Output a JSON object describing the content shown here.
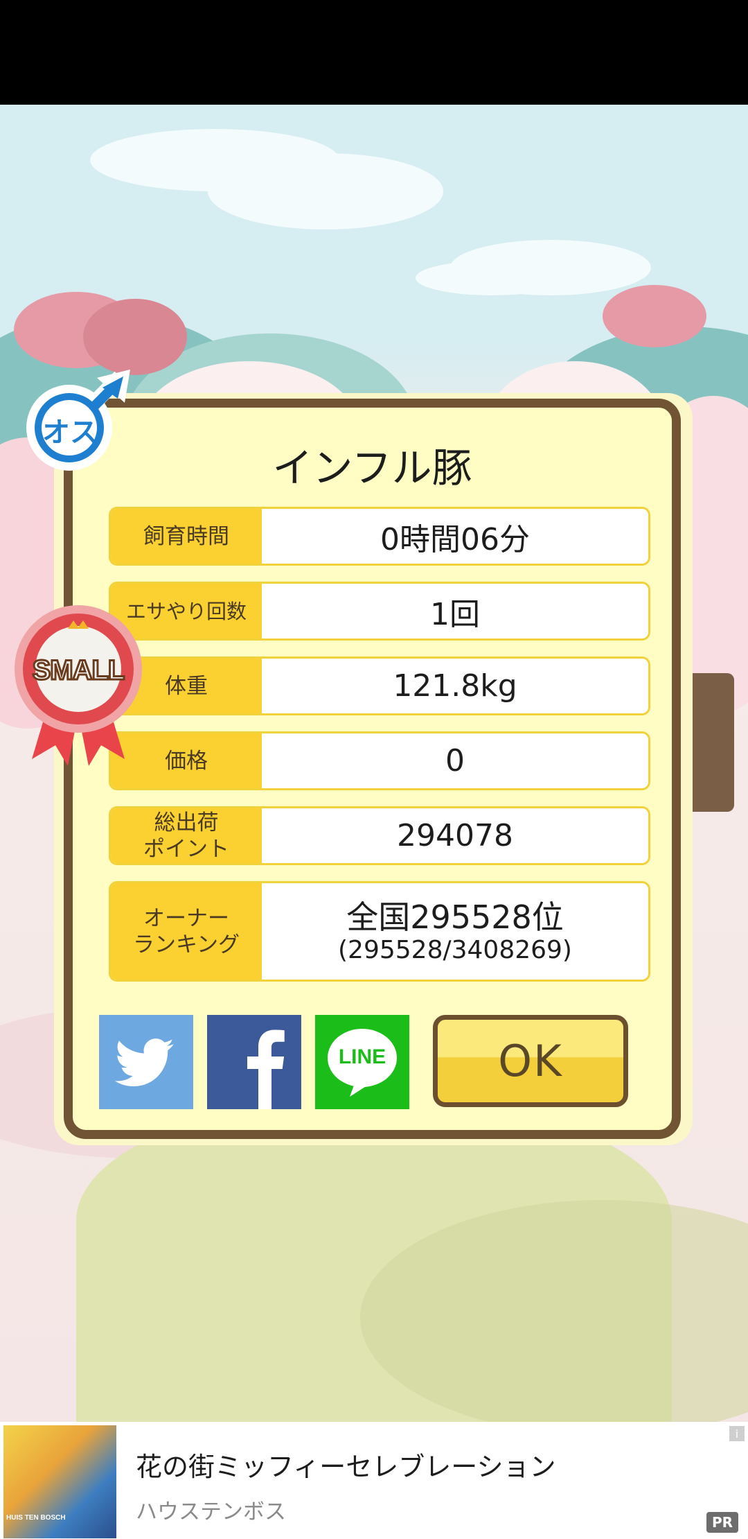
{
  "dialog": {
    "title": "インフル豚",
    "rows": [
      {
        "label": "飼育時間",
        "value": "0時間06分"
      },
      {
        "label": "エサやり回数",
        "value": "1回"
      },
      {
        "label": "体重",
        "value": "121.8kg"
      },
      {
        "label": "価格",
        "value": "0"
      },
      {
        "label_line1": "総出荷",
        "label_line2": "ポイント",
        "value": "294078"
      },
      {
        "label_line1": "オーナー",
        "label_line2": "ランキング",
        "value_line1": "全国295528位",
        "value_line2": "(295528/3408269)"
      }
    ],
    "buttons": {
      "twitter_icon": "twitter-bird-icon",
      "facebook_icon": "facebook-f-icon",
      "line_label": "LINE",
      "ok_label": "OK"
    },
    "badges": {
      "gender_label": "オス",
      "size_label": "SMALL"
    }
  },
  "ad": {
    "title": "花の街ミッフィーセレブレーション",
    "advertiser": "ハウステンボス",
    "pr_label": "PR",
    "info_label": "i",
    "image_text": "HUIS TEN BOSCH"
  }
}
